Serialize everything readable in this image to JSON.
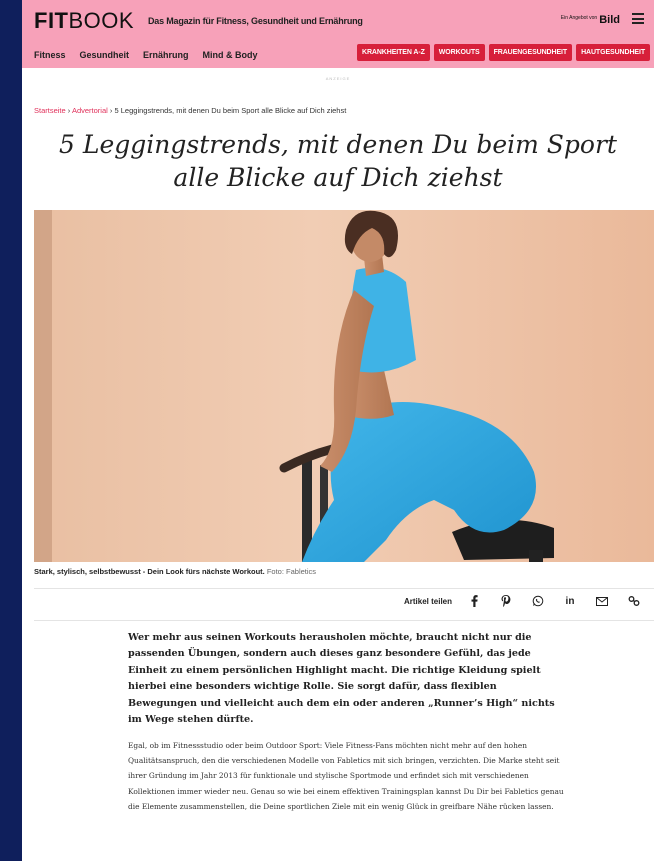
{
  "header": {
    "logo_bold": "FIT",
    "logo_thin": "BOOK",
    "tagline": "Das Magazin für Fitness, Gesundheit und Ernährung",
    "partner_small": "Ein Angebot von",
    "partner_logo": "Bild",
    "nav": [
      "Fitness",
      "Gesundheit",
      "Ernährung",
      "Mind & Body"
    ],
    "pills": [
      "KRANKHEITEN A-Z",
      "WORKOUTS",
      "FRAUENGESUNDHEIT",
      "HAUTGESUNDHEIT"
    ],
    "ad_label": "ANZEIGE",
    "colors": {
      "header_bg": "#f7a1b9",
      "pill_bg": "#d71f3a",
      "page_bg": "#0f1f5c"
    }
  },
  "breadcrumb": {
    "home": "Startseite",
    "section": "Advertorial",
    "current": "5 Leggingstrends, mit denen Du beim Sport alle Blicke auf Dich ziehst",
    "separator": "›"
  },
  "article": {
    "title": "5 Leggingstrends, mit denen Du beim Sport alle Blicke auf Dich ziehst",
    "caption_text": "Stark, stylisch, selbstbewusst - Dein Look fürs nächste Workout.",
    "caption_source": "Foto: Fabletics",
    "share_label": "Artikel teilen",
    "share_icons": [
      "facebook-icon",
      "pinterest-icon",
      "whatsapp-icon",
      "linkedin-icon",
      "email-icon",
      "link-icon"
    ],
    "lead": "Wer mehr aus seinen Workouts herausholen möchte, braucht nicht nur die passenden Übungen, sondern auch dieses ganz besondere Gefühl, das jede Einheit zu einem persönlichen Highlight macht. Die richtige Kleidung spielt hierbei eine besonders wichtige Rolle. Sie sorgt dafür, dass flexiblen Bewegungen und vielleicht auch dem ein oder anderen „Runner’s High“ nichts im Wege stehen dürfte.",
    "body": "Egal, ob im Fitnessstudio oder beim Outdoor Sport: Viele Fitness-Fans möchten nicht mehr auf den hohen Qualitätsanspruch, den die verschiedenen Modelle von Fabletics mit sich bringen, verzichten. Die Marke steht seit ihrer Gründung im Jahr 2013 für funktionale und stylische Sportmode und erfindet sich mit verschiedenen Kollektionen immer wieder neu. Genau so wie bei einem effektiven Trainingsplan kannst Du Dir bei Fabletics genau die Elemente zusammenstellen, die Deine sportlichen Ziele mit ein wenig Glück in greifbare Nähe rücken lassen."
  }
}
